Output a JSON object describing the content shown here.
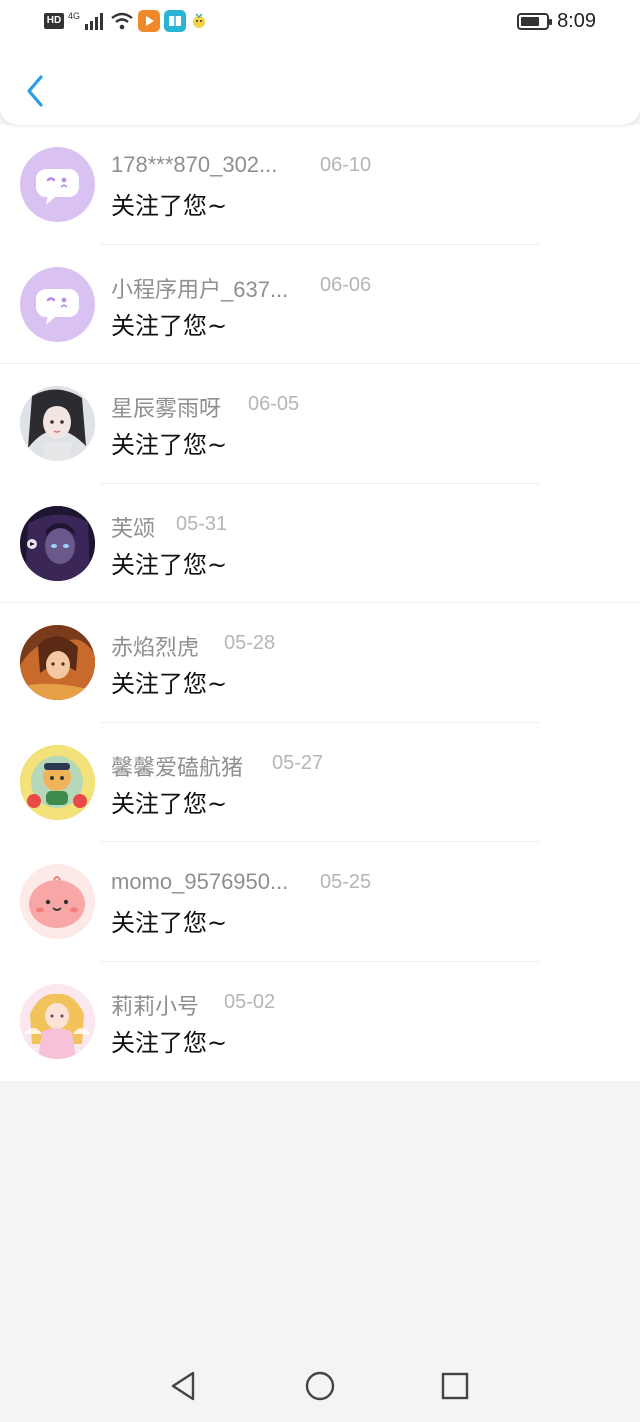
{
  "status_bar": {
    "left": {
      "hd": "HD",
      "network": "4G"
    },
    "time": "8:09"
  },
  "colors": {
    "accent_blue": "#2a9be6",
    "name_gray": "#8f8f8f",
    "date_gray": "#b5b5b5",
    "message_black": "#111111",
    "page_bg": "#f5f4f5"
  },
  "items": [
    {
      "name": "178***870_302...",
      "date": "06-10",
      "message": "关注了您~",
      "avatar": "chat-bubble-default",
      "avatar_bg": "#d9c2f2"
    },
    {
      "name": "小程序用户_637...",
      "date": "06-06",
      "message": "关注了您~",
      "avatar": "chat-bubble-default",
      "avatar_bg": "#d9c2f2"
    },
    {
      "name": "星辰雾雨呀",
      "date": "06-05",
      "message": "关注了您~",
      "avatar": "anime-girl-dark-hair",
      "avatar_bg": "#c9cdd3"
    },
    {
      "name": "芙颂",
      "date": "05-31",
      "message": "关注了您~",
      "avatar": "dark-purple-character",
      "avatar_bg": "#2a1d3a"
    },
    {
      "name": "赤焰烈虎",
      "date": "05-28",
      "message": "关注了您~",
      "avatar": "fire-warrior",
      "avatar_bg": "#b35a2e"
    },
    {
      "name": "馨馨爱磕航猪",
      "date": "05-27",
      "message": "关注了您~",
      "avatar": "colorful-toy",
      "avatar_bg": "#e9c23a"
    },
    {
      "name": "momo_9576950...",
      "date": "05-25",
      "message": "关注了您~",
      "avatar": "pink-blob-face",
      "avatar_bg": "#f7c6c7"
    },
    {
      "name": "莉莉小号",
      "date": "05-02",
      "message": "关注了您~",
      "avatar": "pink-angel-girl",
      "avatar_bg": "#f3d6e6"
    }
  ],
  "icons": {
    "back": "chevron-left-icon",
    "nav_back": "triangle-back-icon",
    "nav_home": "circle-home-icon",
    "nav_recents": "square-recents-icon"
  }
}
